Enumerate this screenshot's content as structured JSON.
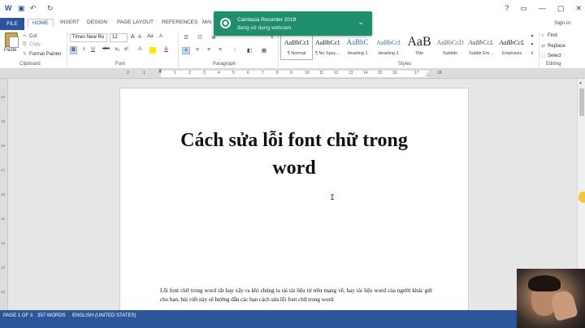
{
  "titlebar": {
    "qa_icons": [
      "word-icon",
      "save-icon",
      "undo-icon",
      "redo-icon"
    ],
    "window_controls": [
      "?",
      "▭",
      "—",
      "▢",
      "✕"
    ]
  },
  "tabs": {
    "file": "FILE",
    "items": [
      "HOME",
      "INSERT",
      "DESIGN",
      "PAGE LAYOUT",
      "REFERENCES",
      "MAI"
    ],
    "active": "HOME",
    "signin": "Sign in"
  },
  "clipboard": {
    "paste": "Paste",
    "cut": "Cut",
    "copy": "Copy",
    "format_painter": "Format Painter",
    "label": "Clipboard"
  },
  "font": {
    "name": "Times New Ro",
    "size": "12",
    "label": "Font",
    "buttons": [
      "B",
      "I",
      "U",
      "abc",
      "x₂",
      "x²"
    ],
    "grow": "A",
    "shrink": "A",
    "case": "Aa",
    "clear": "A"
  },
  "paragraph": {
    "label": "Paragraph",
    "pilcrow": "¶"
  },
  "styles": {
    "label": "Styles",
    "items": [
      {
        "preview": "AaBbCcI",
        "name": "¶ Normal"
      },
      {
        "preview": "AaBbCcI",
        "name": "¶ No Spac..."
      },
      {
        "preview": "AaBbC",
        "name": "Heading 1"
      },
      {
        "preview": "AaBbCcl",
        "name": "Heading 2"
      },
      {
        "preview": "AaB",
        "name": "Title"
      },
      {
        "preview": "AaBbCcD",
        "name": "Subtitle"
      },
      {
        "preview": "AaBbCcL",
        "name": "Subtle Em..."
      },
      {
        "preview": "AaBbCcL",
        "name": "Emphasis"
      }
    ]
  },
  "editing": {
    "label": "Editing",
    "find": "Find",
    "replace": "Replace",
    "select": "Select"
  },
  "ruler": {
    "h_numbers": [
      "2",
      "1",
      "1",
      "2",
      "3",
      "4",
      "5",
      "6",
      "7",
      "8",
      "9",
      "10",
      "11",
      "12",
      "13",
      "14",
      "15",
      "16",
      "17",
      "18"
    ],
    "v_numbers": [
      "20",
      "19",
      "18",
      "17",
      "16",
      "15",
      "14",
      "13",
      "12"
    ]
  },
  "document": {
    "title_line1": "Cách sửa lỗi font chữ trong",
    "title_line2": "word",
    "body": "Lỗi font chữ trong word rất hay xẩy ra khi chúng ta tải tài liệu từ trên mạng về, hay tài liệu word của người khác gửi cho bạn, bài viết này sẽ hướng dẫn các bạn cách sửa lỗi font chữ trong word."
  },
  "status": {
    "page": "PAGE 1 OF 3",
    "words": "357 WORDS",
    "language": "ENGLISH (UNITED STATES)"
  },
  "toast": {
    "title": "Camtasia Recorder 2019",
    "message": "đang sử dụng webcam"
  },
  "colors": {
    "accent": "#2b579a",
    "toast": "#1e8e6e"
  }
}
